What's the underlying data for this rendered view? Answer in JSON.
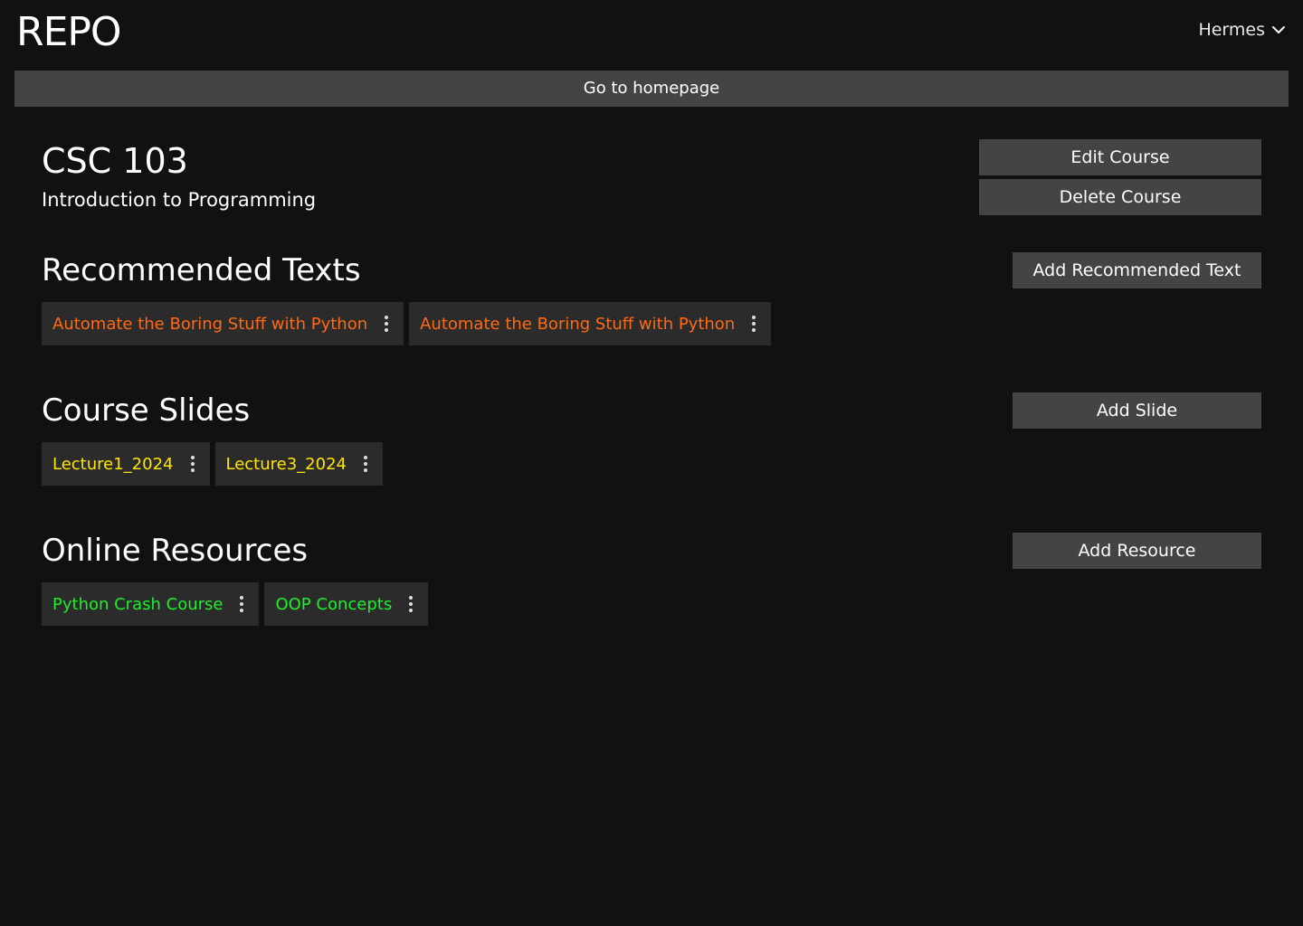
{
  "header": {
    "logo": "REPO",
    "user_name": "Hermes",
    "home_label": "Go to homepage"
  },
  "course": {
    "code": "CSC 103",
    "name": "Introduction to Programming",
    "edit_label": "Edit Course",
    "delete_label": "Delete Course"
  },
  "sections": {
    "texts": {
      "title": "Recommended Texts",
      "add_label": "Add Recommended Text",
      "color": "#ff6a13",
      "items": [
        {
          "label": "Automate the Boring Stuff with Python"
        },
        {
          "label": "Automate the Boring Stuff with Python"
        }
      ]
    },
    "slides": {
      "title": "Course Slides",
      "add_label": "Add Slide",
      "color": "#ffe500",
      "items": [
        {
          "label": "Lecture1_2024"
        },
        {
          "label": "Lecture3_2024"
        }
      ]
    },
    "resources": {
      "title": "Online Resources",
      "add_label": "Add Resource",
      "color": "#1ef02b",
      "items": [
        {
          "label": "Python Crash Course"
        },
        {
          "label": "OOP Concepts"
        }
      ]
    }
  },
  "icons": {
    "user_menu": "chevron-down-icon",
    "item_menu": "more-vertical-icon"
  }
}
